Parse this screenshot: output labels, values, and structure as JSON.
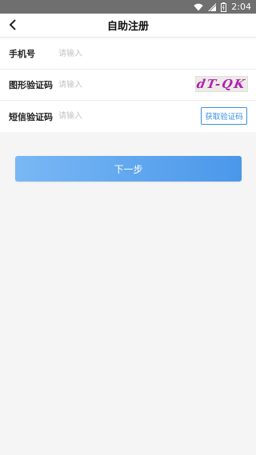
{
  "status_bar": {
    "time": "2:04",
    "icons": [
      "wifi-icon",
      "signal-icon",
      "battery-icon"
    ]
  },
  "nav": {
    "back_icon": "chevron-left-icon",
    "title": "自助注册"
  },
  "form": {
    "phone": {
      "label": "手机号",
      "value": "",
      "placeholder": "请输入"
    },
    "captcha": {
      "label": "图形验证码",
      "value": "",
      "placeholder": "请输入",
      "image_text": "dT-QK"
    },
    "sms": {
      "label": "短信验证码",
      "value": "",
      "placeholder": "请输入",
      "button_label": "获取验证码"
    }
  },
  "next_button": {
    "label": "下一步"
  },
  "colors": {
    "accent": "#3a8ee6",
    "button_gradient_start": "#7ab8f5",
    "button_gradient_end": "#4a97ea",
    "status_bar": "#6f6f6f",
    "background": "#f5f5f5",
    "captcha_text": "#b21fb5"
  }
}
